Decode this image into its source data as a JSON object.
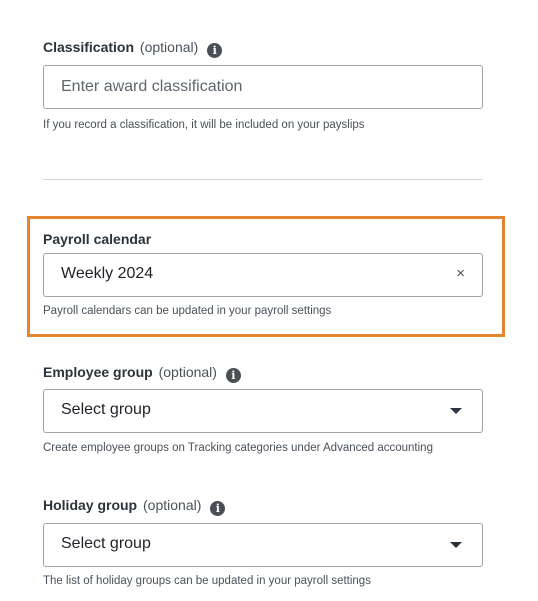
{
  "classification": {
    "label": "Classification",
    "optional": "(optional)",
    "placeholder": "Enter award classification",
    "help": "If you record a classification, it will be included on your payslips"
  },
  "payroll_calendar": {
    "label": "Payroll calendar",
    "value": "Weekly 2024",
    "clear_icon": "×",
    "help": "Payroll calendars can be updated in your payroll settings"
  },
  "employee_group": {
    "label": "Employee group",
    "optional": "(optional)",
    "value": "Select group",
    "help": "Create employee groups on Tracking categories under Advanced accounting"
  },
  "holiday_group": {
    "label": "Holiday group",
    "optional": "(optional)",
    "value": "Select group",
    "help": "The list of holiday groups can be updated in your payroll settings"
  },
  "info_icon_glyph": "i",
  "colors": {
    "highlight": "#e2852e",
    "border": "#9ea4ab",
    "info_icon": "#4a4f55"
  }
}
